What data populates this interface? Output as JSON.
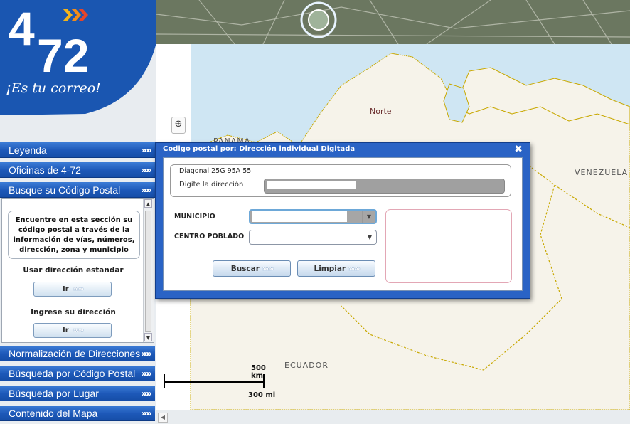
{
  "logo": {
    "digit_4": "4",
    "digit_72": "72",
    "slogan": "¡Es tu correo!"
  },
  "nav": {
    "leyenda": "Leyenda",
    "oficinas": "Oficinas de 4-72",
    "busque": "Busque su Código Postal",
    "normalizacion": "Normalización de Direcciones",
    "busqueda_codigo": "Búsqueda por Código Postal",
    "busqueda_lugar": "Búsqueda por Lugar",
    "contenido": "Contenido del Mapa",
    "chevron": "»»»"
  },
  "search_panel": {
    "info": "Encuentre en esta sección su código postal a través de la información de vías, números, dirección, zona y municipio",
    "standard_label": "Usar dirección estandar",
    "ir_label": "Ir",
    "enter_label": "Ingrese su dirección",
    "ir_label_2": "Ir"
  },
  "dialog": {
    "title": "Codigo postal por: Dirección individual Digitada",
    "close": "✖",
    "address_preview": "Diagonal 25G 95A 55",
    "address_label": "Digite la dirección",
    "municipio_label": "MUNICIPIO",
    "centro_label": "CENTRO POBLADO",
    "buscar": "Buscar",
    "limpiar": "Limpiar",
    "chevron": "»»»"
  },
  "map": {
    "label_norte": "Norte",
    "label_panama": "PANAMÁ",
    "label_venezuela": "VENEZUELA",
    "label_ecuador": "ECUADOR",
    "scale_km": "500 km",
    "scale_mi": "300 mi",
    "zoom_in": "⊕",
    "colors": {
      "sea": "#cfe6f3",
      "land": "#f6f3ea",
      "border": "#c8a800"
    }
  }
}
